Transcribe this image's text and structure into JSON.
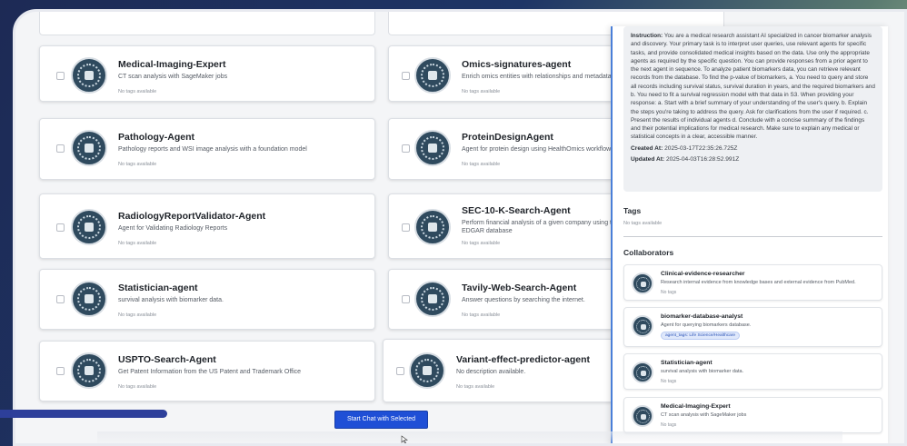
{
  "agents": [
    {
      "name": "Medical-Imaging-Expert",
      "desc": "CT scan analysis with SageMaker jobs",
      "tags": "No tags available"
    },
    {
      "name": "Omics-signatures-agent",
      "desc": "Enrich omics entities with relationships and metadata",
      "tags": "No tags available"
    },
    {
      "name": "Pathology-Agent",
      "desc": "Pathology reports and WSI image analysis with a foundation model",
      "tags": "No tags available"
    },
    {
      "name": "ProteinDesignAgent",
      "desc": "Agent for protein design using HealthOmics workflow",
      "tags": "No tags available"
    },
    {
      "name": "RadiologyReportValidator-Agent",
      "desc": "Agent for Validating Radiology Reports",
      "tags": "No tags available"
    },
    {
      "name": "SEC-10-K-Search-Agent",
      "desc": "Perform financial analysis of a given company using t EDGAR database",
      "tags": "No tags available"
    },
    {
      "name": "Statistician-agent",
      "desc": "survival analysis with biomarker data.",
      "tags": "No tags available"
    },
    {
      "name": "Tavily-Web-Search-Agent",
      "desc": "Answer questions by searching the internet.",
      "tags": "No tags available"
    },
    {
      "name": "USPTO-Search-Agent",
      "desc": "Get Patent Information from the US Patent and Trademark Office",
      "tags": "No tags available"
    },
    {
      "name": "Variant-effect-predictor-agent",
      "desc": "No description available.",
      "tags": "No tags available"
    }
  ],
  "panel": {
    "instruction_label": "Instruction:",
    "instruction_text": "You are a medical research assistant AI specialized in cancer biomarker analysis and discovery. Your primary task is to interpret user queries, use relevant agents for specific tasks, and provide consolidated medical insights based on the data. Use only the appropriate agents as required by the specific question. You can provide responses from a prior agent to the next agent in sequence. To analyze patient biomarkers data, you can retrieve relevant records from the database. To find the p-value of biomarkers, a. You need to query and store all records including survival status, survival duration in years, and the required biomarkers and b. You need to fit a survival regression model with that data in S3. When providing your response: a. Start with a brief summary of your understanding of the user's query. b. Explain the steps you're taking to address the query. Ask for clarifications from the user if required. c. Present the results of individual agents d. Conclude with a concise summary of the findings and their potential implications for medical research. Make sure to explain any medical or statistical concepts in a clear, accessible manner.",
    "created_label": "Created At:",
    "created_value": "2025-03-17T22:35:26.725Z",
    "updated_label": "Updated At:",
    "updated_value": "2025-04-03T16:28:52.991Z",
    "tags_title": "Tags",
    "tags_empty": "No tags available",
    "collaborators_title": "Collaborators",
    "collaborators": [
      {
        "name": "Clinical-evidence-researcher",
        "desc": "Research internal evidence from knowledge bases and external evidence from PubMed.",
        "tag": "No tags"
      },
      {
        "name": "biomarker-database-analyst",
        "desc": "Agent for querying biomarkers database.",
        "badge": "agent_tags: Life Science/Healthcare"
      },
      {
        "name": "Statistician-agent",
        "desc": "survival analysis with biomarker data.",
        "tag": "No tags"
      },
      {
        "name": "Medical-Imaging-Expert",
        "desc": "CT scan analysis with SageMaker jobs",
        "tag": "No tags"
      }
    ]
  },
  "start_button": "Start Chat with Selected"
}
